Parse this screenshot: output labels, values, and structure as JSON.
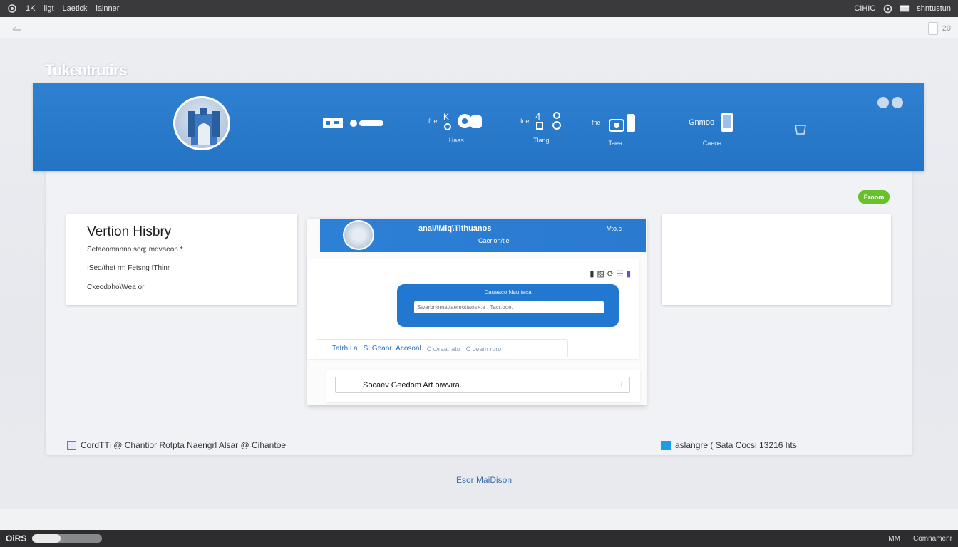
{
  "topbar": {
    "item1": "1K",
    "item2": "ligt",
    "item3": "Laetick",
    "item4": "lainner",
    "right1": "CIHIC",
    "right2": "shntustun"
  },
  "subbar": {
    "right_text": "20"
  },
  "brand": {
    "title": "Tukentrutirs"
  },
  "hero": {
    "nav1": {
      "top": "fne",
      "caption": "Haas"
    },
    "nav2": {
      "top": "fne",
      "caption": "Tlang"
    },
    "nav3": {
      "top": "fne",
      "caption": "Taea"
    },
    "nav4": {
      "top": "Gnmoo",
      "caption": "Caeoa"
    }
  },
  "badge": {
    "label": "Eroom"
  },
  "version_history": {
    "title": "Vertion Hisbry",
    "line1": "Setaeomnnno soq; mdvaeon.*",
    "line2": "ISed/thet rm Fetsng IThinr",
    "line3": "Ckeodoho\\Wea or"
  },
  "middle": {
    "header_title": "anal/\\Miq\\Tithuanos",
    "header_sub": "Caerion/tle",
    "header_right": "Vto.c",
    "box_label": "Daueaco Nau taca",
    "input_placeholder": "Swarbnomattaemottaos+.e . Tacr.ooe.",
    "tab1": "Tatrh i.a",
    "tab2": "SI Geaor .Acosoal",
    "tab3": "C c/raa.ratu",
    "tab4": "C  ceam ruro",
    "search_value": "Socaev Geedom Art oiwvira."
  },
  "footer": {
    "left_text": "CordTTi @ Chantior Rotpta Naengrl Alsar @ Cihantoe",
    "right_text": "aslangre ( Sata Cocsi 13216 hts"
  },
  "bottom_link": "Esor MaiDison",
  "taskbar": {
    "logo": "OiRS",
    "progress": 0.4,
    "right1": "MM",
    "right2": "Comnamenr"
  },
  "colors": {
    "hero_blue": "#2a7acb",
    "badge_green": "#68c02b",
    "footer_square_blue": "#1e9be6",
    "footer_square_violet": "#7b68d6"
  }
}
